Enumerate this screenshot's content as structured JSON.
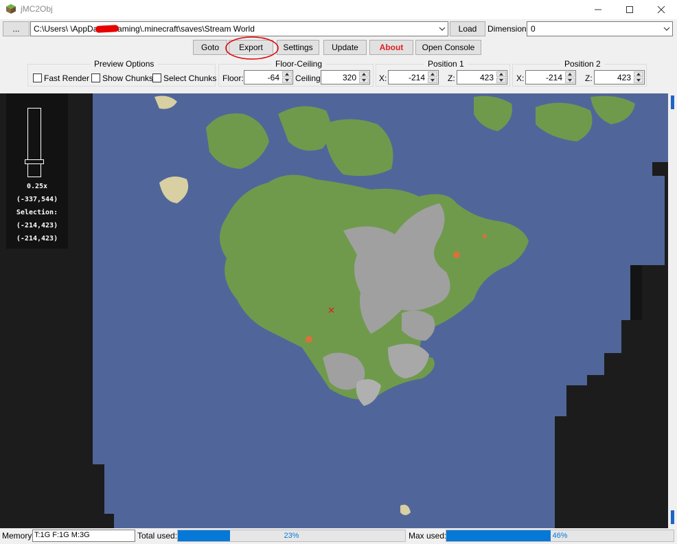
{
  "app": {
    "title": "jMC2Obj"
  },
  "toolbar": {
    "browse_label": "...",
    "path_value": "C:\\Users\\      \\AppData\\Roaming\\.minecraft\\saves\\Stream World",
    "load_label": "Load",
    "dimension_label": "Dimension:",
    "dimension_value": "0"
  },
  "actions": {
    "goto": "Goto",
    "export": "Export",
    "settings": "Settings",
    "update": "Update",
    "about": "About",
    "open_console": "Open Console"
  },
  "preview_options": {
    "title": "Preview Options",
    "fast_render": "Fast Render",
    "show_chunks": "Show Chunks",
    "select_chunks": "Select Chunks"
  },
  "floor_ceiling": {
    "title": "Floor-Ceiling",
    "floor_label": "Floor:",
    "floor_value": "-64",
    "ceiling_label": "Ceiling:",
    "ceiling_value": "320"
  },
  "position1": {
    "title": "Position 1",
    "x_label": "X:",
    "x_value": "-214",
    "z_label": "Z:",
    "z_value": "423"
  },
  "position2": {
    "title": "Position 2",
    "x_label": "X:",
    "x_value": "-214",
    "z_label": "Z:",
    "z_value": "423"
  },
  "map_overlay": {
    "zoom": "0.25x",
    "cursor_coords": "(-337,544)",
    "selection_label": "Selection:",
    "selection_start": "(-214,423)",
    "selection_end": "(-214,423)",
    "zoom_level_fraction": 0.8
  },
  "status": {
    "memory_label": "Memory:",
    "memory_value": "T:1G F:1G M:3G",
    "total_used_label": "Total used:",
    "total_used_value": "23%",
    "total_used_fraction": 0.23,
    "max_used_label": "Max used:",
    "max_used_value": "46%",
    "max_used_fraction": 0.46
  },
  "colors": {
    "accent": "#0678d7",
    "about_text": "#e02020",
    "ocean": "#50669a",
    "grass": "#6f9a4c",
    "stone": "#a0a0a0",
    "unexplored": "#1c1c1c",
    "annotation_circle": "#e00000"
  },
  "icons": {
    "app": "grass-block-icon",
    "minimize": "minimize-icon",
    "maximize": "maximize-icon",
    "close": "close-icon",
    "combo": "chevron-down-icon"
  }
}
